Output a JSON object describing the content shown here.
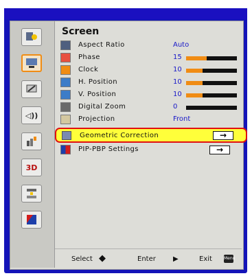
{
  "menu": {
    "title": "Screen",
    "items": [
      {
        "label": "Aspect Ratio",
        "value": "Auto",
        "icon": "aspect-ratio-icon"
      },
      {
        "label": "Phase",
        "value": "15",
        "level": 0.4,
        "icon": "phase-icon"
      },
      {
        "label": "Clock",
        "value": "10",
        "level": 0.33,
        "icon": "clock-icon"
      },
      {
        "label": "H. Position",
        "value": "10",
        "level": 0.33,
        "icon": "h-position-icon"
      },
      {
        "label": "V. Position",
        "value": "10",
        "level": 0.33,
        "icon": "v-position-icon"
      },
      {
        "label": "Digital Zoom",
        "value": "0",
        "level": 0.0,
        "icon": "digital-zoom-icon"
      },
      {
        "label": "Projection",
        "value": "Front",
        "icon": "projection-icon"
      },
      {
        "label": "Geometric Correction",
        "arrow": "→",
        "icon": "geometric-correction-icon"
      },
      {
        "label": "PIP-PBP Settings",
        "arrow": "→",
        "icon": "pip-pbp-icon"
      }
    ]
  },
  "sidebar": {
    "items": [
      {
        "name": "image-settings-icon"
      },
      {
        "name": "screen-settings-icon"
      },
      {
        "name": "setting-icon"
      },
      {
        "name": "volume-icon",
        "text": "◁))"
      },
      {
        "name": "options-icon"
      },
      {
        "name": "3d-icon",
        "text": "3D"
      },
      {
        "name": "lan-icon"
      },
      {
        "name": "exit-icon"
      }
    ]
  },
  "footer": {
    "select_label": "Select",
    "select_icon": "◆",
    "enter_label": "Enter",
    "enter_icon": "▶",
    "exit_label": "Exit",
    "menu_key": "Menu"
  },
  "colors": {
    "frame": "#1414b8",
    "accent": "#f08c14",
    "value_text": "#1818c8",
    "highlight": "#ffff3a",
    "highlight_border": "#e01010"
  }
}
